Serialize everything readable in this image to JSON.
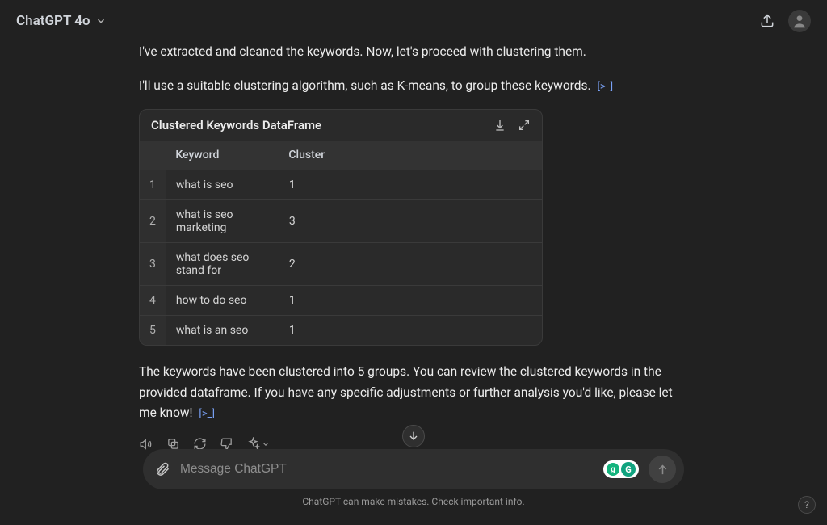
{
  "header": {
    "model": "ChatGPT 4o"
  },
  "messages": {
    "p1": "I've extracted and cleaned the keywords. Now, let's proceed with clustering them.",
    "p2": "I'll use a suitable clustering algorithm, such as K-means, to group these keywords.",
    "p3": "The keywords have been clustered into 5 groups. You can review the clustered keywords in the provided dataframe. If you have any specific adjustments or further analysis you'd like, please let me know!",
    "code_link": "[>_]"
  },
  "dataframe": {
    "title": "Clustered Keywords DataFrame",
    "columns": {
      "idx": "",
      "c1": "Keyword",
      "c2": "Cluster",
      "c3": ""
    },
    "rows": [
      {
        "idx": "1",
        "keyword": "what is seo",
        "cluster": "1"
      },
      {
        "idx": "2",
        "keyword": "what is seo marketing",
        "cluster": "3"
      },
      {
        "idx": "3",
        "keyword": "what does seo stand for",
        "cluster": "2"
      },
      {
        "idx": "4",
        "keyword": "how to do seo",
        "cluster": "1"
      },
      {
        "idx": "5",
        "keyword": "what is an seo",
        "cluster": "1"
      }
    ]
  },
  "input": {
    "placeholder": "Message ChatGPT"
  },
  "disclaimer": "ChatGPT can make mistakes. Check important info.",
  "help": "?"
}
